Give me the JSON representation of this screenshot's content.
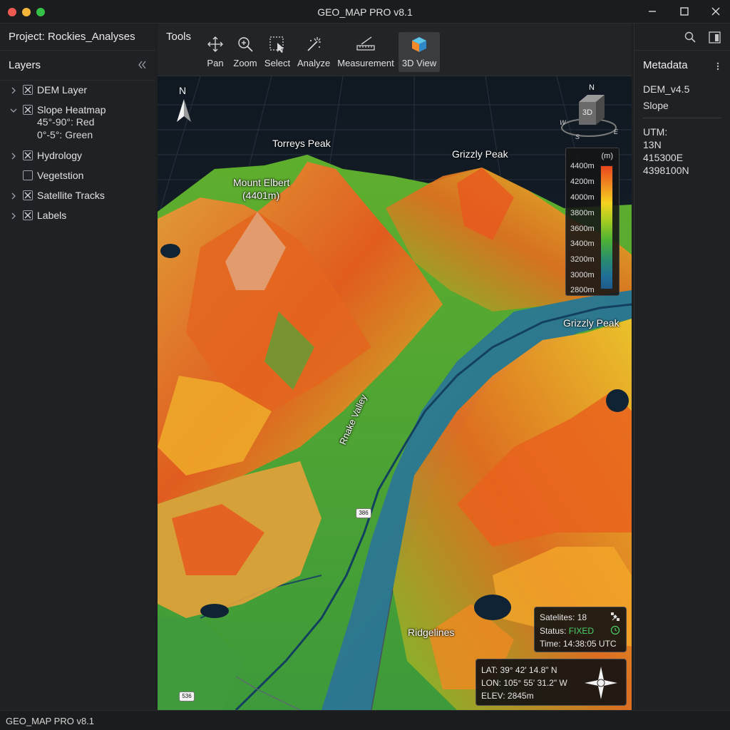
{
  "window": {
    "title": "GEO_MAP PRO v8.1"
  },
  "project": {
    "label": "Project: Rockies_Analyses"
  },
  "layers_panel": {
    "title": "Layers",
    "items": [
      {
        "label": "DEM Layer",
        "checked": true,
        "expandable": true
      },
      {
        "label": "Slope Heatmap",
        "checked": true,
        "expandable": true,
        "expanded": true,
        "sub": [
          "45°-90°: Red",
          "0°-5°: Green"
        ]
      },
      {
        "label": "Hydrology",
        "checked": true,
        "expandable": true
      },
      {
        "label": "Vegetstion",
        "checked": false,
        "expandable": false
      },
      {
        "label": "Satellite Tracks",
        "checked": true,
        "expandable": true
      },
      {
        "label": "Labels",
        "checked": true,
        "expandable": true
      }
    ]
  },
  "toolbar": {
    "title": "Tools",
    "tools": [
      {
        "label": "Pan",
        "icon": "pan-icon"
      },
      {
        "label": "Zoom",
        "icon": "zoom-icon"
      },
      {
        "label": "Select",
        "icon": "select-icon"
      },
      {
        "label": "Analyze",
        "icon": "analyze-icon"
      },
      {
        "label": "Measurement",
        "icon": "measurement-icon"
      },
      {
        "label": "3D View",
        "icon": "cube-3d-icon",
        "active": true
      }
    ]
  },
  "map": {
    "north_label": "N",
    "cube": {
      "face_label": "3D",
      "n": "N",
      "w": "W",
      "s": "S",
      "e": "E"
    },
    "peaks": {
      "torreys": "Torreys Peak",
      "grizzly_top": "Grizzly Peak",
      "grizzly_right": "Grizzly Peak",
      "elbert_name": "Mount Elbert",
      "elbert_elev": "(4401m)",
      "ridgelines": "Ridgelines",
      "valley": "Rnake Valley"
    },
    "route_shields": [
      "386",
      "536"
    ],
    "legend": {
      "unit": "(m)",
      "ticks": [
        "4400m",
        "4200m",
        "4000m",
        "3800m",
        "3600m",
        "3400m",
        "3200m",
        "3000m",
        "2800m"
      ],
      "colors": [
        "#e8451d",
        "#f5d21f",
        "#4fb233",
        "#1e5a8a"
      ]
    },
    "gps": {
      "satellites": "Satelites: 18",
      "status_label": "Status: ",
      "status_value": "FIXED",
      "time": "Time: 14:38:05 UTC",
      "status_color": "#4bd16b"
    },
    "coords": {
      "lat": "LAT: 39° 42' 14.8\" N",
      "lon": "LON: 105° 55' 31.2\" W",
      "elev": "ELEV: 2845m"
    }
  },
  "metadata": {
    "title": "Metadata",
    "dem": "DEM_v4.5",
    "layer": "Slope",
    "utm_label": "UTM:",
    "zone": "13N",
    "easting": "415300E",
    "northing": "4398100N"
  },
  "statusbar": {
    "text": "GEO_MAP PRO v8.1"
  }
}
